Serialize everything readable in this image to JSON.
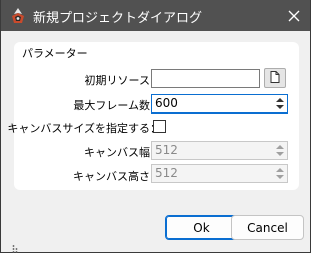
{
  "window": {
    "title": "新規プロジェクトダイアログ",
    "icons": {
      "app": "app-icon",
      "close": "close-icon"
    }
  },
  "group": {
    "title": "パラメーター",
    "fields": [
      {
        "key": "initial_resource",
        "label": "初期リソース：",
        "value": "",
        "icon": "file-icon"
      },
      {
        "key": "max_frames",
        "label": "最大フレーム数：",
        "value": "600"
      },
      {
        "key": "specify_canvas_size",
        "label": "キャンバスサイズを指定する：",
        "checked": false
      },
      {
        "key": "canvas_width",
        "label": "キャンバス幅：",
        "value": "512"
      },
      {
        "key": "canvas_height",
        "label": "キャンバス高さ：",
        "value": "512"
      }
    ]
  },
  "buttons": {
    "ok": "Ok",
    "cancel": "Cancel"
  },
  "colors": {
    "titlebar": "#515151",
    "accent": "#0a6ed1",
    "background": "#f0f0f0"
  }
}
